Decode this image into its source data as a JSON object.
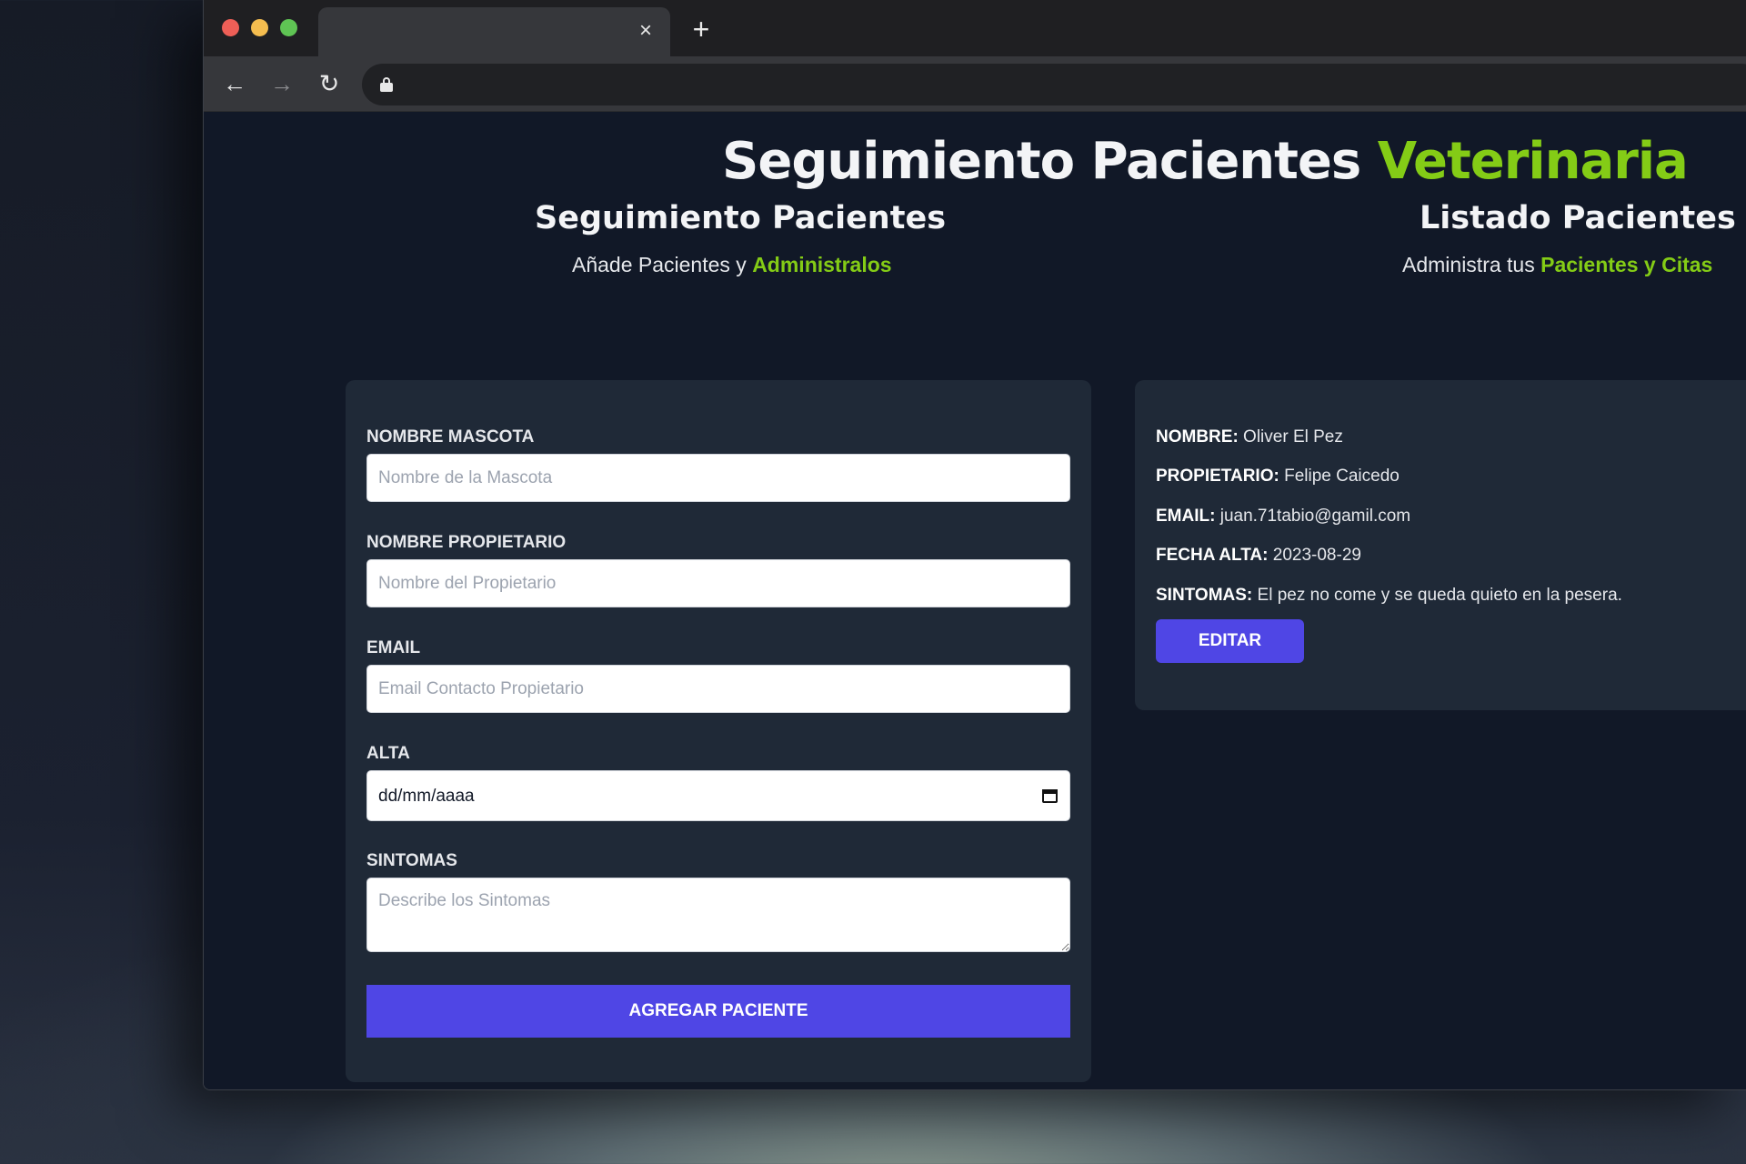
{
  "browser": {
    "tab_close_icon": "×",
    "new_tab_icon": "+",
    "back_icon": "←",
    "forward_icon": "→",
    "reload_icon": "↻",
    "url": ""
  },
  "header": {
    "title_main": "Seguimiento Pacientes ",
    "title_highlight": "Veterinaria"
  },
  "form_section": {
    "title": "Seguimiento Pacientes",
    "subtitle_prefix": "Añade Pacientes y ",
    "subtitle_highlight": "Administralos",
    "fields": {
      "mascota": {
        "label": "NOMBRE MASCOTA",
        "placeholder": "Nombre de la Mascota",
        "value": ""
      },
      "propietario": {
        "label": "NOMBRE PROPIETARIO",
        "placeholder": "Nombre del Propietario",
        "value": ""
      },
      "email": {
        "label": "EMAIL",
        "placeholder": "Email Contacto Propietario",
        "value": ""
      },
      "alta": {
        "label": "ALTA",
        "display": "dd/mm/aaaa"
      },
      "sintomas": {
        "label": "SINTOMAS",
        "placeholder": "Describe los Sintomas",
        "value": ""
      }
    },
    "submit_label": "AGREGAR PACIENTE"
  },
  "list_section": {
    "title": "Listado Pacientes",
    "subtitle_prefix": "Administra tus ",
    "subtitle_highlight": "Pacientes y Citas",
    "patients": [
      {
        "nombre_label": "NOMBRE:",
        "nombre": " Oliver El Pez",
        "propietario_label": "PROPIETARIO:",
        "propietario": " Felipe Caicedo",
        "email_label": "EMAIL:",
        "email": " juan.71tabio@gamil.com",
        "fecha_label": "FECHA ALTA:",
        "fecha": " 2023-08-29",
        "sintomas_label": "SINTOMAS:",
        "sintomas": " El pez no come y se queda quieto en la pesera.",
        "edit_label": "EDITAR"
      }
    ]
  },
  "colors": {
    "accent_green": "#84cc16",
    "button_indigo": "#4f46e5",
    "page_bg": "#111827",
    "card_bg": "#1f2937"
  }
}
